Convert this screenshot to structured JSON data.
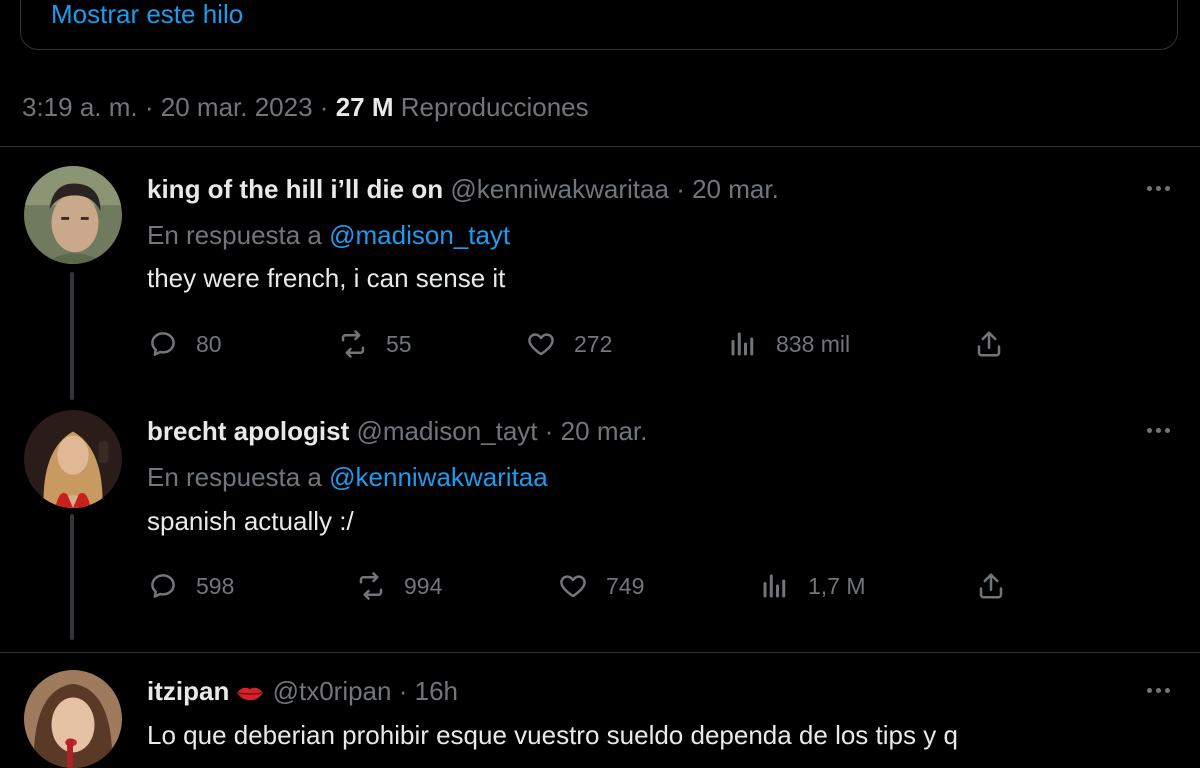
{
  "thread_link": {
    "label": "Mostrar este hilo"
  },
  "meta": {
    "time": "3:19 a. m.",
    "date": "20 mar. 2023",
    "views_count": "27 M",
    "views_label": "Reproducciones",
    "separator": "·"
  },
  "replies": [
    {
      "display_name": "king of the hill i’ll die on",
      "handle": "@kenniwakwaritaa",
      "time": "20 mar.",
      "reply_prefix": "En respuesta a",
      "reply_to": "@madison_tayt",
      "text": "they were french, i can sense it",
      "stats": {
        "replies": "80",
        "reposts": "55",
        "likes": "272",
        "views": "838 mil"
      }
    },
    {
      "display_name": "brecht apologist",
      "handle": "@madison_tayt",
      "time": "20 mar.",
      "reply_prefix": "En respuesta a",
      "reply_to": "@kenniwakwaritaa",
      "text": "spanish actually :/",
      "stats": {
        "replies": "598",
        "reposts": "994",
        "likes": "749",
        "views": "1,7 M"
      }
    },
    {
      "display_name": "itzipan",
      "handle": "@tx0ripan",
      "time": "16h",
      "text": "Lo que deberian prohibir esque vuestro sueldo dependa de los tips y q"
    }
  ],
  "icons": {
    "reply": "reply-icon",
    "repost": "repost-icon",
    "like": "heart-icon",
    "views": "views-icon",
    "share": "share-icon",
    "more": "more-icon",
    "lips_emoji": "lips-emoji-icon"
  },
  "colors": {
    "background": "#000000",
    "text": "#e7e9ea",
    "muted": "#71767b",
    "accent": "#1d9bf0",
    "border": "#2f3336"
  }
}
